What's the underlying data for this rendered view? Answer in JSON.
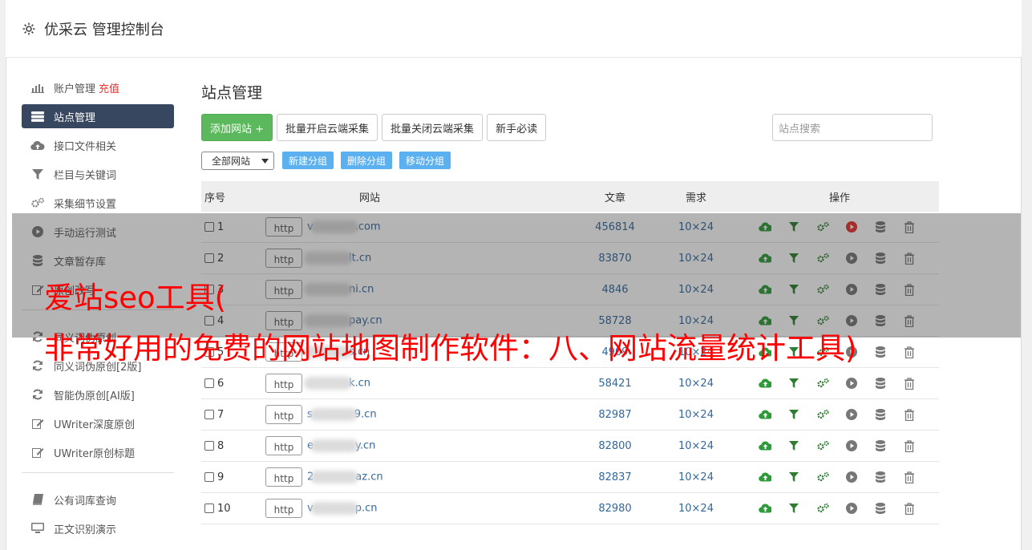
{
  "app": {
    "title": "优采云 管理控制台"
  },
  "sidebar": {
    "items": [
      {
        "label": "账户管理",
        "extra": "充值",
        "icon": "bar-chart-icon"
      },
      {
        "label": "站点管理",
        "icon": "server-icon",
        "active": true
      },
      {
        "label": "接口文件相关",
        "icon": "cloud-upload-icon"
      },
      {
        "label": "栏目与关键词",
        "icon": "filter-icon"
      },
      {
        "label": "采集细节设置",
        "icon": "gears-icon"
      },
      {
        "label": "手动运行测试",
        "icon": "play-circle-icon"
      },
      {
        "label": "文章暂存库",
        "icon": "database-icon"
      },
      {
        "label": "原创改写",
        "icon": "edit-icon"
      },
      {
        "label": "同义词伪原创",
        "icon": "refresh-icon"
      },
      {
        "label": "同义词伪原创[2版]",
        "icon": "refresh-icon"
      },
      {
        "label": "智能伪原创[AI版]",
        "icon": "refresh-icon"
      },
      {
        "label": "UWriter深度原创",
        "icon": "edit-icon"
      },
      {
        "label": "UWriter原创标题",
        "icon": "edit-icon"
      }
    ],
    "items2": [
      {
        "label": "公有词库查询",
        "icon": "book-icon"
      },
      {
        "label": "正文识别演示",
        "icon": "monitor-icon"
      }
    ]
  },
  "main": {
    "title": "站点管理",
    "toolbar": {
      "add": "添加网站 +",
      "batch_open": "批量开启云端采集",
      "batch_close": "批量关闭云端采集",
      "guide": "新手必读"
    },
    "search_placeholder": "站点搜索",
    "group_select": "全部网站",
    "group_buttons": {
      "new": "新建分组",
      "delete": "删除分组",
      "move": "移动分组"
    }
  },
  "table": {
    "headers": {
      "no": "序号",
      "site": "网站",
      "articles": "文章",
      "demand": "需求",
      "ops": "操作"
    },
    "rows": [
      {
        "no": "1",
        "prefix": "http",
        "domain_pre": "v",
        "domain_post": ".com",
        "articles": "456814",
        "demand": "10×24",
        "running": true
      },
      {
        "no": "2",
        "prefix": "http",
        "domain_pre": "",
        "domain_post": "lt.cn",
        "articles": "83870",
        "demand": "10×24",
        "running": false
      },
      {
        "no": "3",
        "prefix": "http",
        "domain_pre": "",
        "domain_post": "ni.cn",
        "articles": "4846",
        "demand": "10×24",
        "running": false
      },
      {
        "no": "4",
        "prefix": "http",
        "domain_pre": "",
        "domain_post": "pay.cn",
        "articles": "58728",
        "demand": "10×24",
        "running": false
      },
      {
        "no": "5",
        "prefix": "http",
        "domain_pre": "",
        "domain_post": "s.cn",
        "articles": "4909",
        "demand": "10×24",
        "running": false
      },
      {
        "no": "6",
        "prefix": "http",
        "domain_pre": "",
        "domain_post": "k.cn",
        "articles": "58421",
        "demand": "10×24",
        "running": false
      },
      {
        "no": "7",
        "prefix": "http",
        "domain_pre": "s",
        "domain_post": "9.cn",
        "articles": "82987",
        "demand": "10×24",
        "running": false
      },
      {
        "no": "8",
        "prefix": "http",
        "domain_pre": "e",
        "domain_post": "y.cn",
        "articles": "82800",
        "demand": "10×24",
        "running": false
      },
      {
        "no": "9",
        "prefix": "http",
        "domain_pre": "2",
        "domain_post": "az.cn",
        "articles": "82837",
        "demand": "10×24",
        "running": false
      },
      {
        "no": "10",
        "prefix": "http",
        "domain_pre": "v",
        "domain_post": "p.cn",
        "articles": "82980",
        "demand": "10×24",
        "running": false
      }
    ]
  },
  "overlay": {
    "line1": "爱站seo工具(",
    "line2": "非常好用的免费的网站地图制作软件：八、网站流量统计工具)"
  },
  "colors": {
    "accent_active": "#37475f",
    "green": "#5cb85c",
    "link": "#34679a",
    "red": "#ff0000"
  }
}
